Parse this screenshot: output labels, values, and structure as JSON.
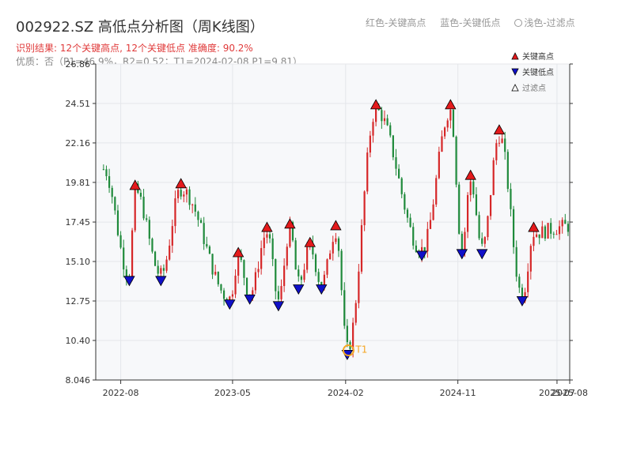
{
  "page": {
    "title": "002922.SZ 高低点分析图（周K线图）",
    "header_legend": {
      "red": "红色-关键高点",
      "blue": "蓝色-关键低点",
      "light": "浅色-过滤点"
    },
    "subtitle": "识别结果: 12个关键高点, 12个关键低点   准确度: 90.2%",
    "quality": "优质：否（P1=46.9%，R2=0.52；T1=2024-02-08 P1=9.81）"
  },
  "colors": {
    "up": "#d62728",
    "down": "#1f8a3b",
    "high_marker": "#e41a1c",
    "low_marker": "#1010c8",
    "t1": "#f5a623",
    "plot_bg": "#f7f8fa",
    "grid": "#e4e6ea"
  },
  "chart_data": {
    "type": "candlestick",
    "title": "002922.SZ 高低点分析图（周K线图）",
    "ylim": [
      8.046,
      26.86
    ],
    "y_ticks": [
      8.046,
      10.4,
      12.75,
      15.1,
      17.45,
      19.81,
      22.16,
      24.51,
      26.86
    ],
    "y_tick_labels": [
      "8.046",
      "10.40",
      "12.75",
      "15.10",
      "17.45",
      "19.81",
      "22.16",
      "24.51",
      "26.86"
    ],
    "x_range": [
      "2022-06-01",
      "2025-08-01"
    ],
    "x_ticks": [
      "2022-08",
      "2023-05",
      "2024-02",
      "2024-11",
      "2025-07",
      "2025-08"
    ],
    "grid": true,
    "legend_position": "top-right",
    "legend": [
      {
        "symbol": "triangle-up",
        "label": "关键高点"
      },
      {
        "symbol": "triangle-down",
        "label": "关键低点"
      },
      {
        "symbol": "triangle-up-outline",
        "label": "过滤点"
      }
    ],
    "key_highs": [
      {
        "x": "2022-09-05",
        "y": 19.3
      },
      {
        "x": "2022-12-26",
        "y": 19.4
      },
      {
        "x": "2023-05-15",
        "y": 15.3
      },
      {
        "x": "2023-07-24",
        "y": 16.8
      },
      {
        "x": "2023-09-18",
        "y": 17.0
      },
      {
        "x": "2023-11-06",
        "y": 15.9
      },
      {
        "x": "2024-01-08",
        "y": 16.9
      },
      {
        "x": "2024-04-15",
        "y": 24.1
      },
      {
        "x": "2024-10-14",
        "y": 24.1
      },
      {
        "x": "2024-12-02",
        "y": 19.9
      },
      {
        "x": "2025-02-10",
        "y": 22.6
      },
      {
        "x": "2025-05-05",
        "y": 16.8
      }
    ],
    "key_lows": [
      {
        "x": "2022-08-22",
        "y": 14.3
      },
      {
        "x": "2022-11-07",
        "y": 14.3
      },
      {
        "x": "2023-04-24",
        "y": 12.9
      },
      {
        "x": "2023-06-12",
        "y": 13.2
      },
      {
        "x": "2023-08-21",
        "y": 12.8
      },
      {
        "x": "2023-10-09",
        "y": 13.8
      },
      {
        "x": "2023-12-04",
        "y": 13.8
      },
      {
        "x": "2024-02-05",
        "y": 9.9
      },
      {
        "x": "2024-08-05",
        "y": 15.8
      },
      {
        "x": "2024-11-11",
        "y": 15.9
      },
      {
        "x": "2024-12-30",
        "y": 15.9
      },
      {
        "x": "2025-04-07",
        "y": 13.1
      }
    ],
    "t1": {
      "x": "2024-02-08",
      "y": 9.81,
      "label": "T1"
    }
  }
}
